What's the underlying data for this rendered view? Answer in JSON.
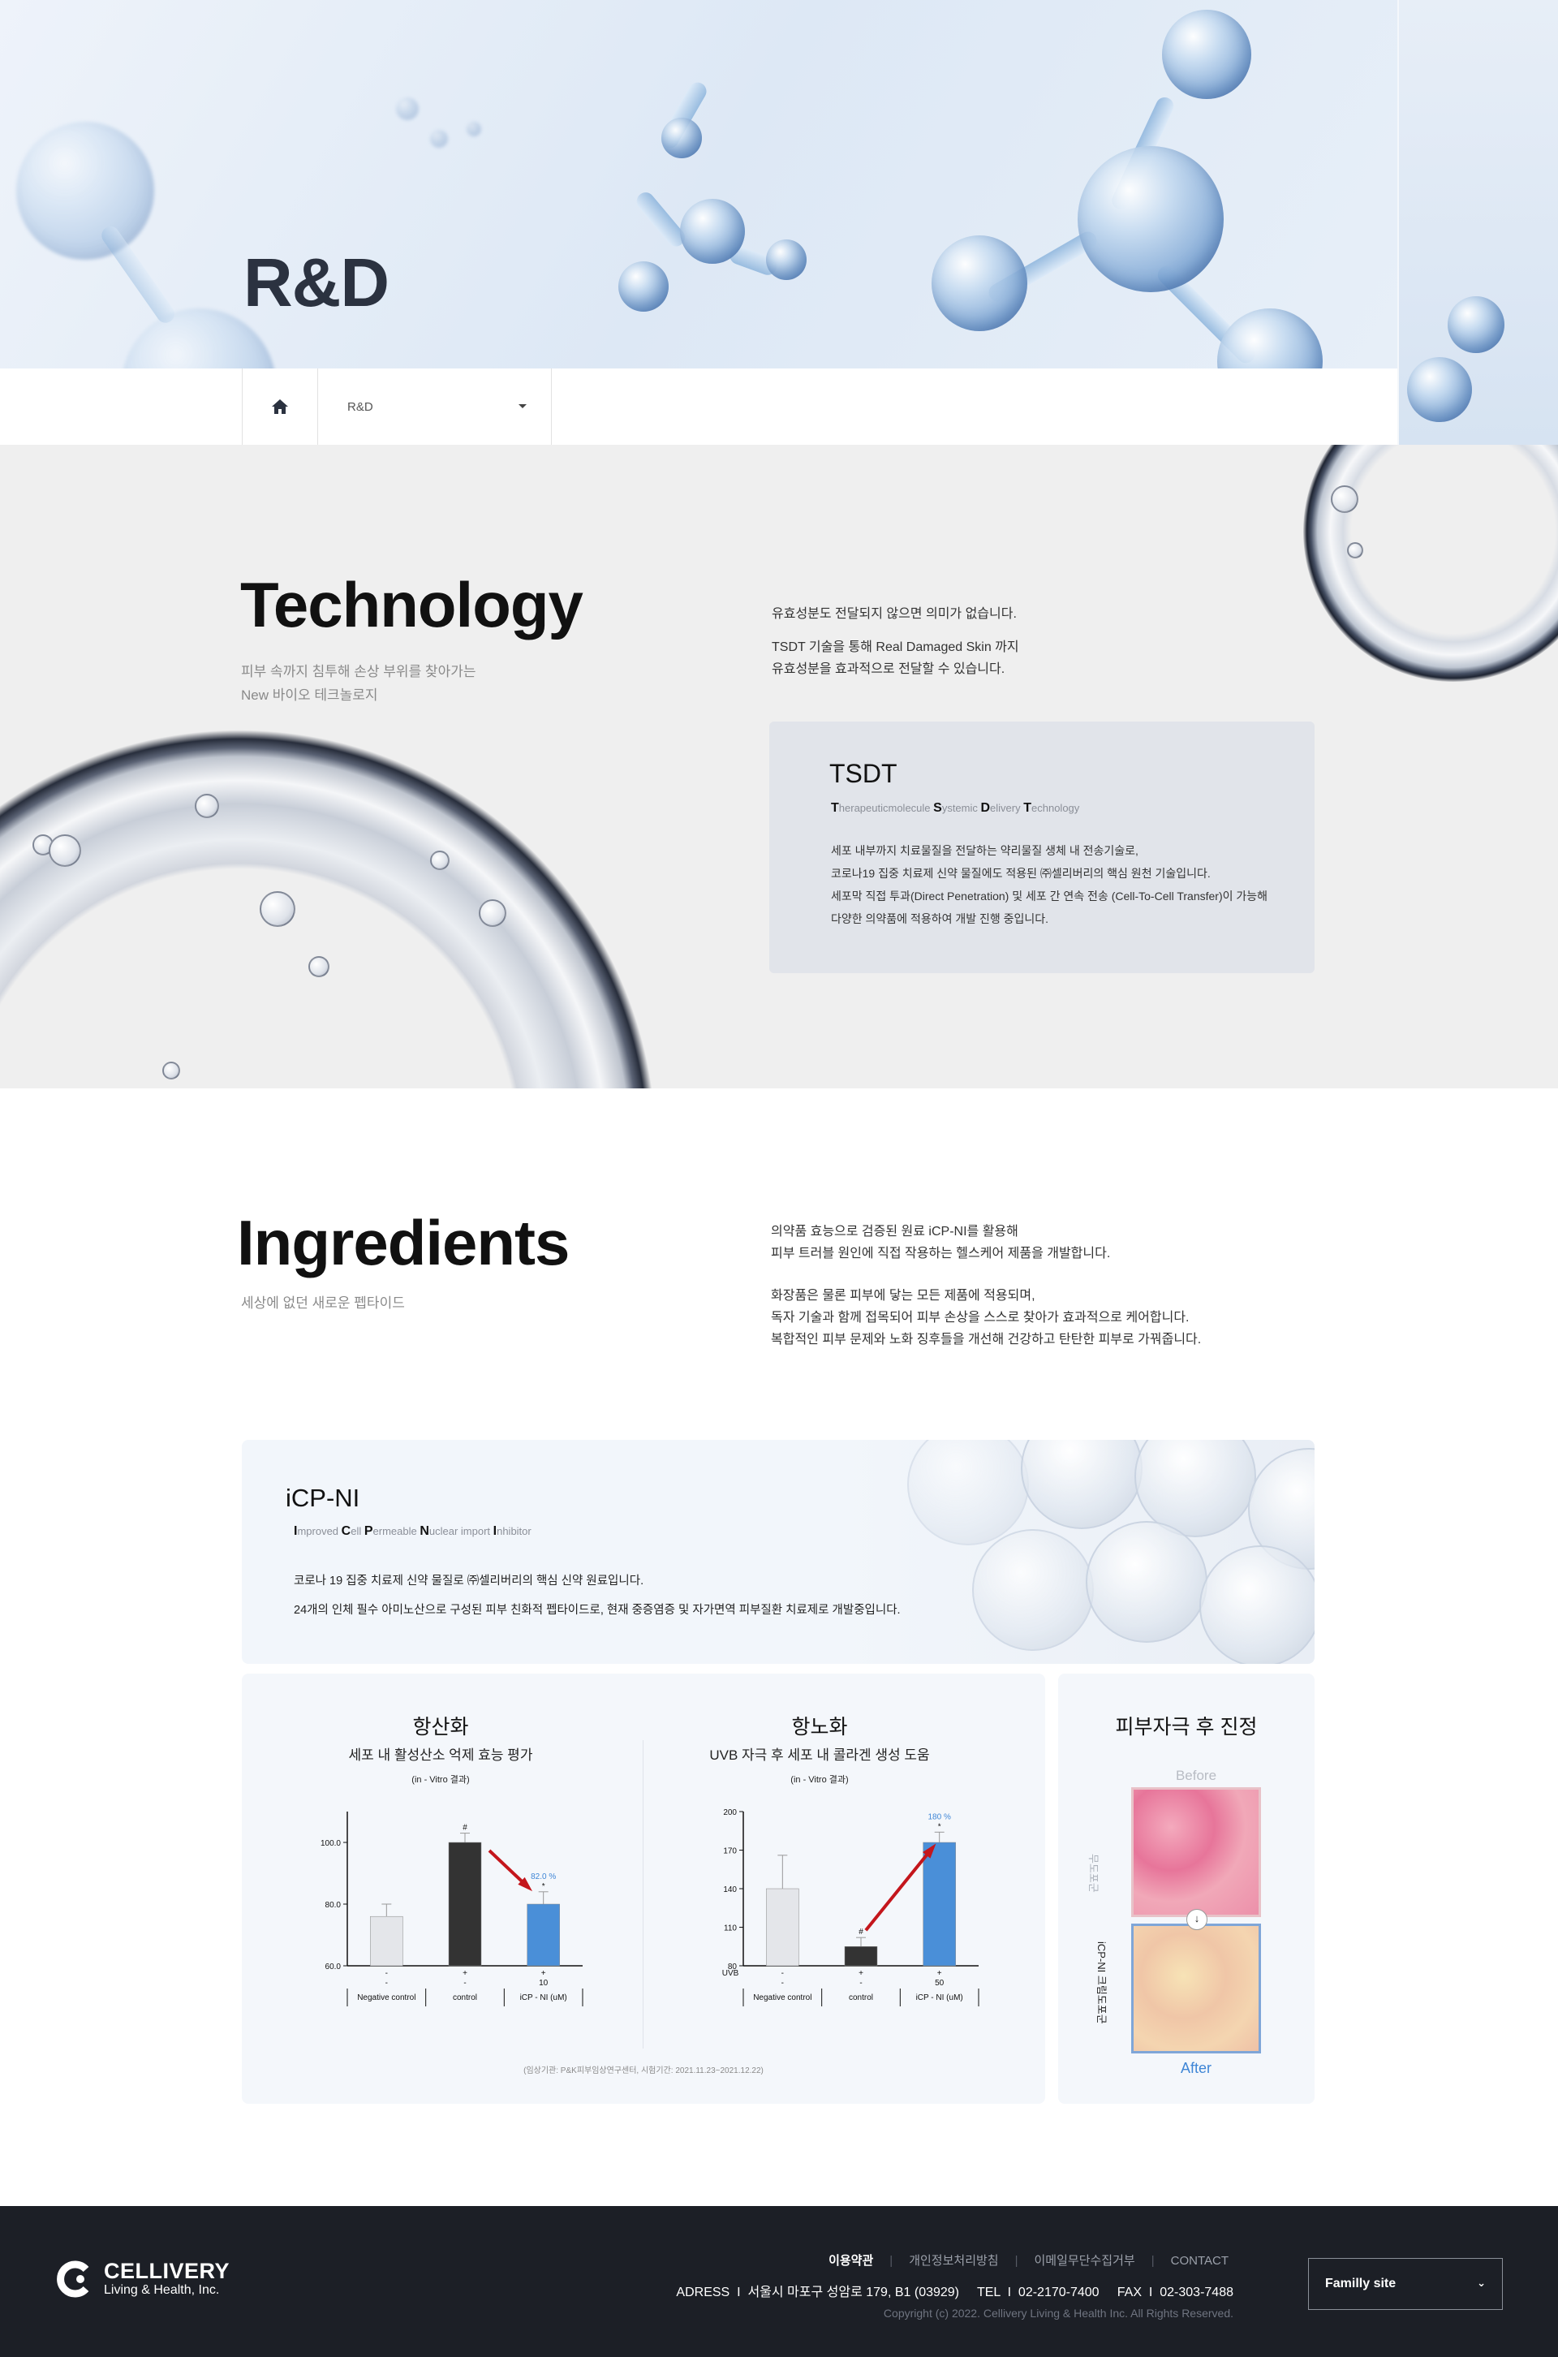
{
  "hero": {
    "title": "R&D"
  },
  "breadcrumb": {
    "home_icon": "home-icon",
    "current": "R&D",
    "caret_icon": "caret-down-icon"
  },
  "technology": {
    "title": "Technology",
    "subtitle": [
      "피부 속까지 침투해 손상 부위를 찾아가는",
      "New 바이오 테크놀로지"
    ],
    "intro": [
      "유효성분도 전달되지 않으면 의미가 없습니다.",
      "TSDT 기술을 통해 Real Damaged Skin 까지",
      "유효성분을 효과적으로 전달할 수 있습니다."
    ],
    "tsdt": {
      "title": "TSDT",
      "acronym": [
        {
          "initial": "T",
          "rest": "herapeuticmolecule "
        },
        {
          "initial": "S",
          "rest": "ystemic "
        },
        {
          "initial": "D",
          "rest": "elivery "
        },
        {
          "initial": "T",
          "rest": "echnology"
        }
      ],
      "body": [
        "세포 내부까지 치료물질을 전달하는 약리물질 생체 내 전송기술로,",
        "코로나19 집중 치료제 신약 물질에도 적용된 ㈜셀리버리의 핵심 원천 기술입니다.",
        "세포막 직접 투과(Direct Penetration) 및 세포 간 연속 전송 (Cell-To-Cell Transfer)이 가능해",
        "다양한 의약품에 적용하여 개발 진행 중입니다."
      ]
    }
  },
  "ingredients": {
    "title": "Ingredients",
    "subtitle": "세상에 없던 새로운 펩타이드",
    "intro_1": [
      "의약품 효능으로 검증된 원료 iCP-NI를 활용해",
      "피부 트러블 원인에 직접 작용하는 헬스케어 제품을 개발합니다."
    ],
    "intro_2": [
      "화장품은 물론 피부에 닿는 모든 제품에 적용되며,",
      "독자 기술과 함께 접목되어 피부 손상을 스스로 찾아가 효과적으로 케어합니다.",
      "복합적인 피부 문제와 노화 징후들을 개선해 건강하고 탄탄한 피부로 가꿔줍니다."
    ],
    "icp": {
      "title": "iCP-NI",
      "acronym": [
        {
          "initial": "I",
          "rest": "mproved "
        },
        {
          "initial": "C",
          "rest": "ell "
        },
        {
          "initial": "P",
          "rest": "ermeable "
        },
        {
          "initial": "N",
          "rest": "uclear import "
        },
        {
          "initial": "I",
          "rest": "nhibitor"
        }
      ],
      "body": [
        "코로나 19 집중 치료제 신약 물질로 ㈜셀리버리의 핵심 신약 원료입니다.",
        "24개의 인체 필수 아미노산으로 구성된 피부 친화적 펩타이드로, 현재 중증염증 및 자가면역 피부질환 치료제로 개발중입니다."
      ]
    },
    "source_note": "(임상기관: P&K피부임상연구센터, 시험기간: 2021.11.23~2021.12.22)",
    "after_card": {
      "title": "피부자극 후 진정",
      "before": "Before",
      "after": "After",
      "side_top": "무도포군",
      "side_bottom": "iCP-NI 크림도포군",
      "arrow_icon": "arrow-down-icon"
    }
  },
  "chart_data": [
    {
      "type": "bar",
      "title": "항산화",
      "subtitle": "세포 내 활성산소 억제 효능 평가",
      "note": "(in - Vitro 결과)",
      "categories": [
        "Negative control",
        "control",
        "iCP - NI (uM)"
      ],
      "row1": [
        "-",
        "+",
        "+"
      ],
      "row2": [
        "-",
        "-",
        "10"
      ],
      "values": [
        76,
        100,
        80
      ],
      "errors": [
        4,
        3,
        4
      ],
      "colors": [
        "#e4e6ea",
        "#333333",
        "#4a8fd8"
      ],
      "markers": [
        "",
        "#",
        "*"
      ],
      "ylim": [
        60,
        110
      ],
      "yticks": [
        "60.0",
        "80.0",
        "100.0"
      ],
      "label": "82.0 %",
      "arrow": "down"
    },
    {
      "type": "bar",
      "title": "항노화",
      "subtitle": "UVB 자극 후 세포 내 콜라겐 생성 도움",
      "note": "(in - Vitro 결과)",
      "row_label": "UVB",
      "categories": [
        "Negative control",
        "control",
        "iCP - NI (uM)"
      ],
      "row1": [
        "-",
        "+",
        "+"
      ],
      "row2": [
        "-",
        "-",
        "50"
      ],
      "values": [
        140,
        95,
        176
      ],
      "errors": [
        26,
        7,
        8
      ],
      "colors": [
        "#e4e6ea",
        "#333333",
        "#4a8fd8"
      ],
      "markers": [
        "",
        "#",
        "*"
      ],
      "ylim": [
        80,
        200
      ],
      "yticks": [
        "80",
        "110",
        "140",
        "170",
        "200"
      ],
      "label": "180 %",
      "arrow": "up"
    }
  ],
  "footer": {
    "links": [
      "이용약관",
      "개인정보처리방침",
      "이메일무단수집거부",
      "CONTACT"
    ],
    "address": "ADRESS  I  서울시 마포구 성암로 179, B1 (03929)     TEL  I  02-2170-7400     FAX  I  02-303-7488",
    "copyright": "Copyright (c) 2022. Cellivery Living & Health Inc. All Rights Reserved.",
    "family_site": "Familly site",
    "logo_line1": "CELLIVERY",
    "logo_line2": "Living & Health, Inc."
  }
}
